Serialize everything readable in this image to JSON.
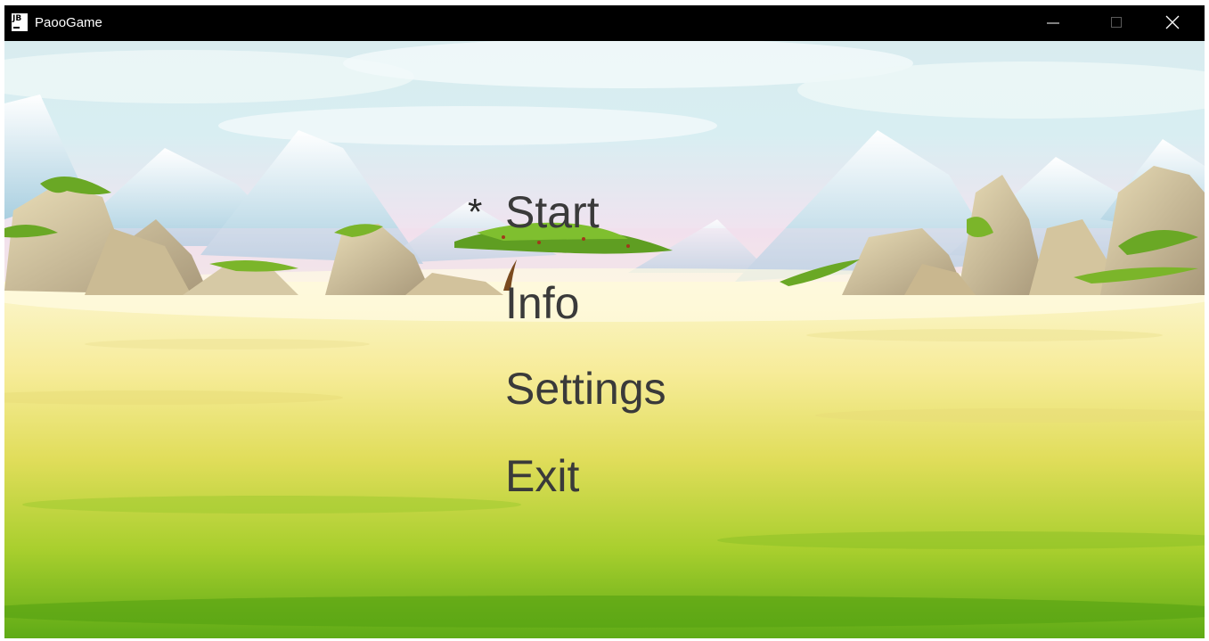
{
  "window": {
    "title": "PaooGame",
    "icon": "jb-app-icon",
    "controls": [
      "minimize-icon",
      "maximize-icon",
      "close-icon"
    ]
  },
  "menu": {
    "selector": "*",
    "selected_index": 0,
    "items": [
      {
        "label": "Start"
      },
      {
        "label": "Info"
      },
      {
        "label": "Settings"
      },
      {
        "label": "Exit"
      }
    ]
  },
  "colors": {
    "titlebar": "#000000",
    "menu_text": "#3a3a3a",
    "sky_top": "#cfe8ee",
    "ground_bottom": "#6fb31c"
  }
}
